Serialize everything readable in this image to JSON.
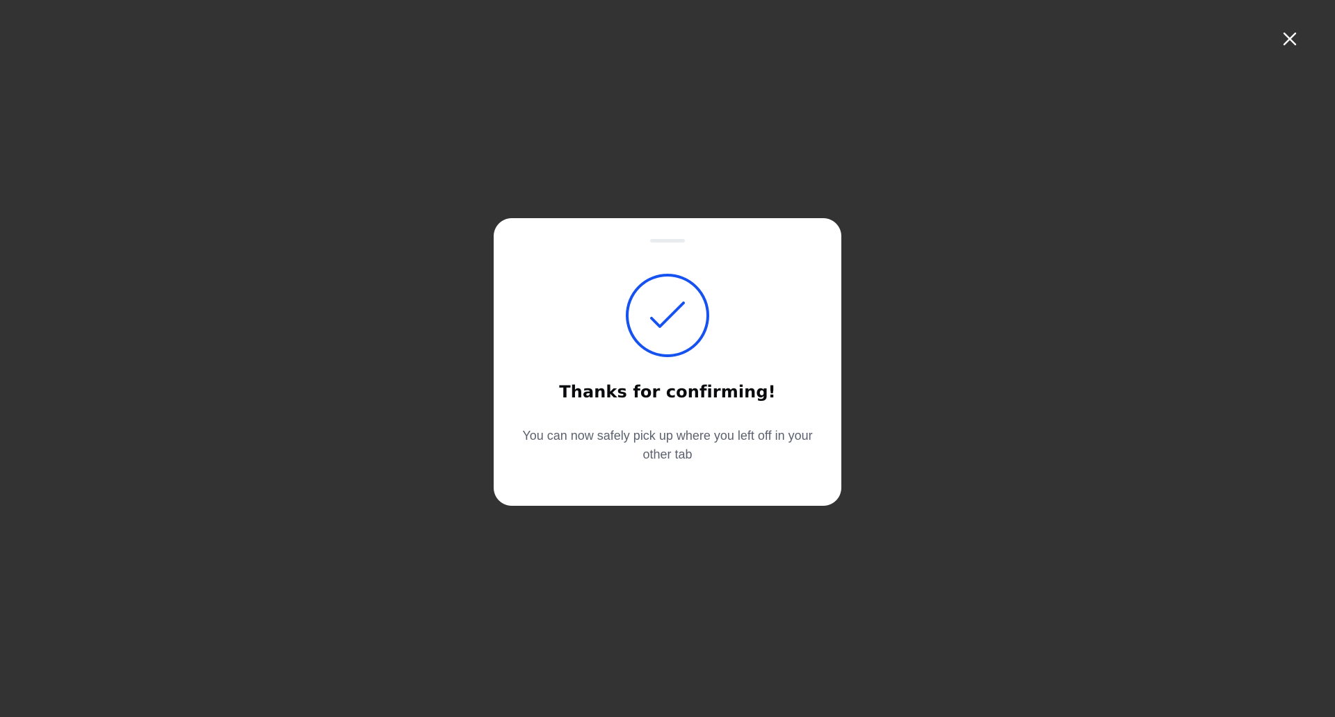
{
  "overlay": {
    "background_color": "#333333",
    "close_icon": "close-icon",
    "close_icon_color": "#ffffff"
  },
  "modal": {
    "background_color": "#ffffff",
    "status_icon": "checkmark-circle-icon",
    "accent_color": "#1652f0",
    "title": "Thanks for confirming!",
    "message": "You can now safely pick up where you left off in your other tab"
  }
}
